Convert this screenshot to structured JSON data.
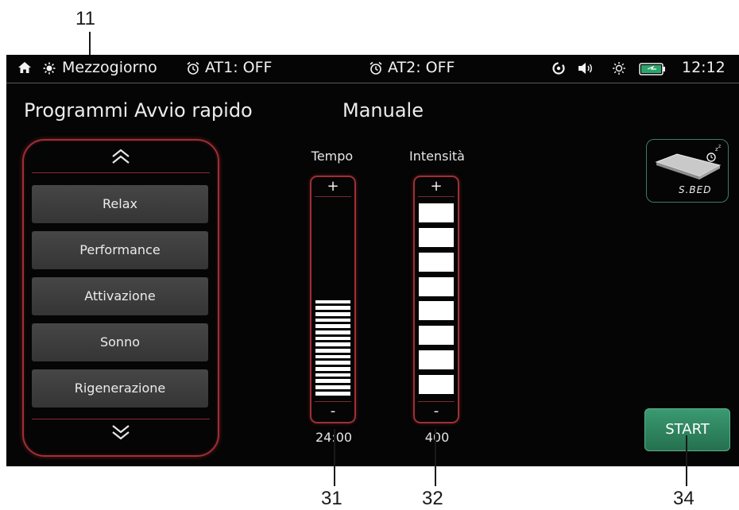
{
  "callouts": {
    "mode_callout": "11",
    "tempo_callout": "31",
    "intensita_callout": "32",
    "start_callout": "34"
  },
  "status": {
    "mode": "Mezzogiorno",
    "alarm1": "AT1: OFF",
    "alarm2": "AT2: OFF",
    "time": "12:12",
    "icons": [
      "home-icon",
      "sun-icon",
      "alarm-clock-icon",
      "sync-icon",
      "speaker-icon",
      "brightness-icon",
      "battery-icon"
    ]
  },
  "headings": {
    "quick_programs": "Programmi Avvio rapido",
    "manual": "Manuale"
  },
  "programs": [
    {
      "label": "Relax"
    },
    {
      "label": "Performance"
    },
    {
      "label": "Attivazione"
    },
    {
      "label": "Sonno"
    },
    {
      "label": "Rigenerazione"
    }
  ],
  "tempo": {
    "label": "Tempo",
    "plus": "+",
    "minus": "-",
    "value": "24:00",
    "segments_total": 32,
    "segments_filled": 16
  },
  "intensita": {
    "label": "Intensità",
    "plus": "+",
    "minus": "-",
    "value": "400",
    "segments_total": 8,
    "segments_filled": 8
  },
  "device": {
    "label": "S.BED"
  },
  "start_label": "START",
  "colors": {
    "accent_red": "#9e2f35",
    "start_green": "#2e8660",
    "device_border": "#3f7a6e"
  }
}
